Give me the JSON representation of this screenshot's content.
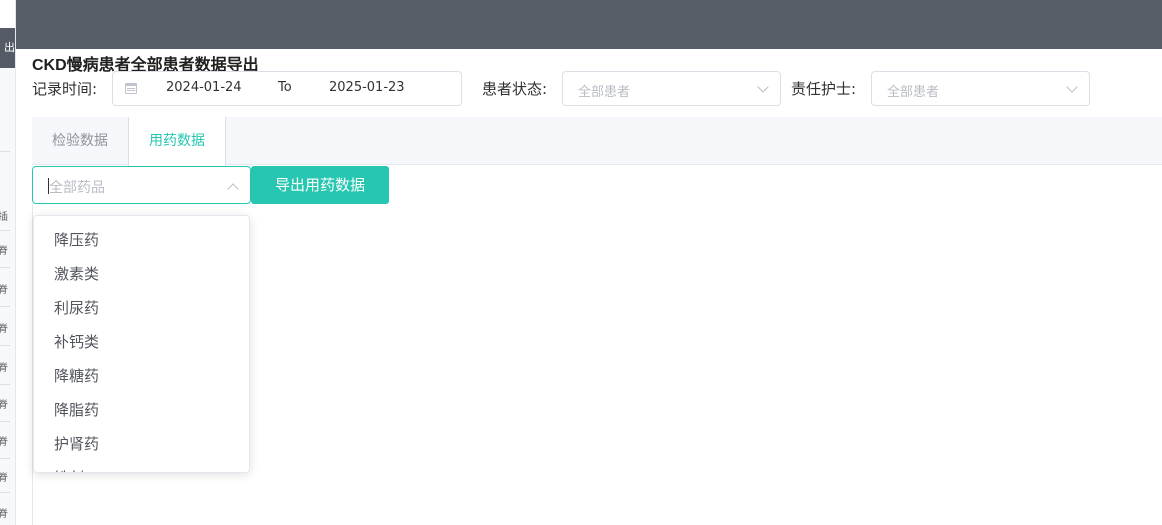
{
  "background": {
    "sidebar_glyph": "出",
    "row_glyphs": [
      "插",
      "脊",
      "脊",
      "脊",
      "脊",
      "脊",
      "脊",
      "脊",
      "脊",
      "脊"
    ]
  },
  "dialog": {
    "title": "CKD慢病患者全部患者数据导出",
    "record_time_label": "记录时间:",
    "date_start": "2024-01-24",
    "date_separator": "To",
    "date_end": "2025-01-23",
    "patient_status_label": "患者状态:",
    "patient_status_placeholder": "全部患者",
    "nurse_label": "责任护士:",
    "nurse_placeholder": "全部患者"
  },
  "tabs": [
    {
      "label": "检验数据",
      "active": false
    },
    {
      "label": "用药数据",
      "active": true
    }
  ],
  "drug_filter": {
    "placeholder": "全部药品",
    "export_button": "导出用药数据",
    "options": [
      "降压药",
      "激素类",
      "利尿药",
      "补钙类",
      "降糖药",
      "降脂药",
      "护肾药",
      "铁剂"
    ]
  },
  "colors": {
    "accent": "#26c6b0",
    "overlay": "#575e68"
  },
  "icons": {
    "date": "calendar-icon",
    "select": "chevron-down-icon",
    "open_select": "chevron-up-icon"
  }
}
